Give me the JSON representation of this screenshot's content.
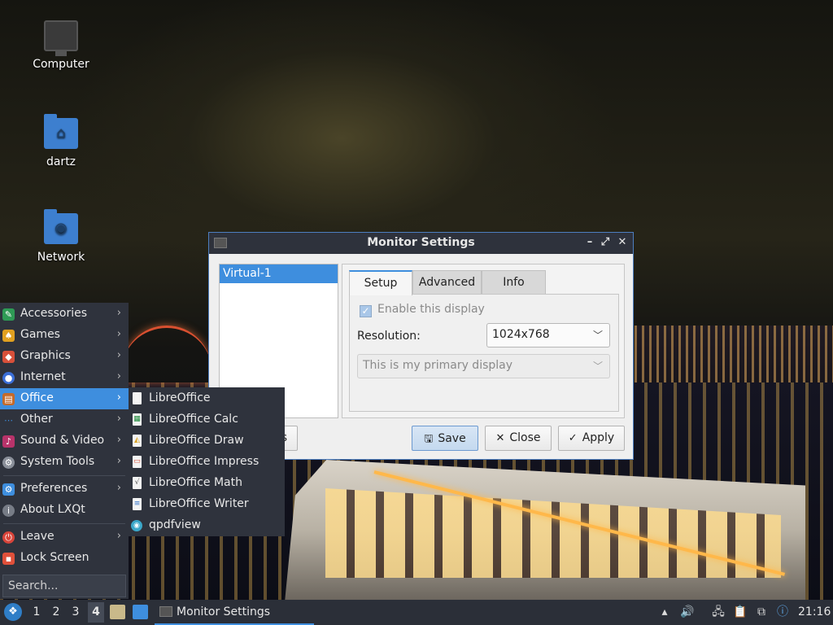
{
  "desktop": {
    "icons": [
      {
        "label": "Computer",
        "icon": "computer-icon"
      },
      {
        "label": "dartz",
        "icon": "home-folder-icon"
      },
      {
        "label": "Network",
        "icon": "network-folder-icon"
      }
    ]
  },
  "window": {
    "title": "Monitor Settings",
    "monitors": [
      "Virtual-1"
    ],
    "tabs": [
      "Setup",
      "Advanced",
      "Info"
    ],
    "active_tab": "Setup",
    "enable_display_label": "Enable this display",
    "enable_display_checked": true,
    "resolution_label": "Resolution:",
    "resolution_value": "1024x768",
    "primary_display_value": "This is my primary display",
    "partial_button_label": "s",
    "buttons": {
      "save": "Save",
      "close": "Close",
      "apply": "Apply"
    }
  },
  "menu": {
    "items": [
      {
        "label": "Accessories",
        "icon": "accessories-icon",
        "color": "#2e9a55"
      },
      {
        "label": "Games",
        "icon": "games-icon",
        "color": "#e0a020"
      },
      {
        "label": "Graphics",
        "icon": "graphics-icon",
        "color": "#d8503a"
      },
      {
        "label": "Internet",
        "icon": "internet-icon",
        "color": "#3b6fd8"
      },
      {
        "label": "Office",
        "icon": "office-icon",
        "color": "#c46a2a"
      },
      {
        "label": "Other",
        "icon": "other-icon",
        "color": "#3e8ede"
      },
      {
        "label": "Sound & Video",
        "icon": "sound-video-icon",
        "color": "#b8336a"
      },
      {
        "label": "System Tools",
        "icon": "system-tools-icon",
        "color": "#8a8f99"
      },
      {
        "label": "Preferences",
        "icon": "preferences-icon",
        "color": "#3e8ede"
      },
      {
        "label": "About LXQt",
        "icon": "about-icon",
        "color": "#777c86"
      },
      {
        "label": "Leave",
        "icon": "power-icon",
        "color": "#d8443a"
      },
      {
        "label": "Lock Screen",
        "icon": "lock-icon",
        "color": "#e0503a"
      }
    ],
    "active": "Office",
    "search_placeholder": "Search..."
  },
  "submenu": {
    "items": [
      "LibreOffice",
      "LibreOffice Calc",
      "LibreOffice Draw",
      "LibreOffice Impress",
      "LibreOffice Math",
      "LibreOffice Writer",
      "qpdfview"
    ]
  },
  "taskbar": {
    "desktops": [
      "1",
      "2",
      "3",
      "4"
    ],
    "active_desktop": "4",
    "task_label": "Monitor Settings",
    "clock": "21:16"
  },
  "colors": {
    "accent": "#3e8ede",
    "panel": "#2f333d",
    "titlebar": "#2e323c"
  }
}
